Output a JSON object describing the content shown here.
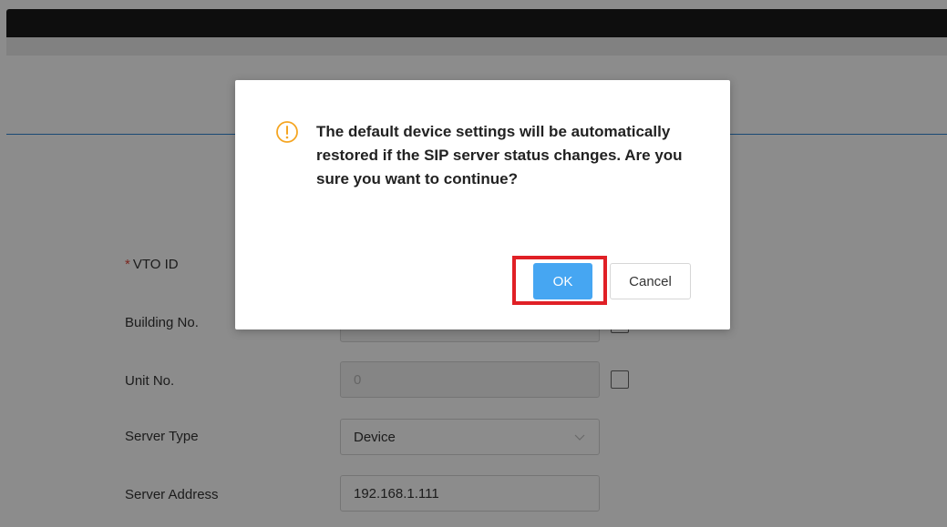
{
  "form": {
    "vto_id": {
      "label": "VTO ID",
      "required_mark": "*"
    },
    "building_no": {
      "label": "Building No."
    },
    "unit_no": {
      "label": "Unit No.",
      "value": "0"
    },
    "server_type": {
      "label": "Server Type",
      "value": "Device"
    },
    "server_address": {
      "label": "Server Address",
      "value": "192.168.1.111"
    }
  },
  "dialog": {
    "message": "The default device settings will be automatically restored if the SIP server status changes. Are you sure you want to continue?",
    "ok_label": "OK",
    "cancel_label": "Cancel",
    "icon": "warning-circle-icon",
    "colors": {
      "icon": "#f5a623",
      "ok_bg": "#46a6f2",
      "highlight": "#e02026"
    }
  }
}
